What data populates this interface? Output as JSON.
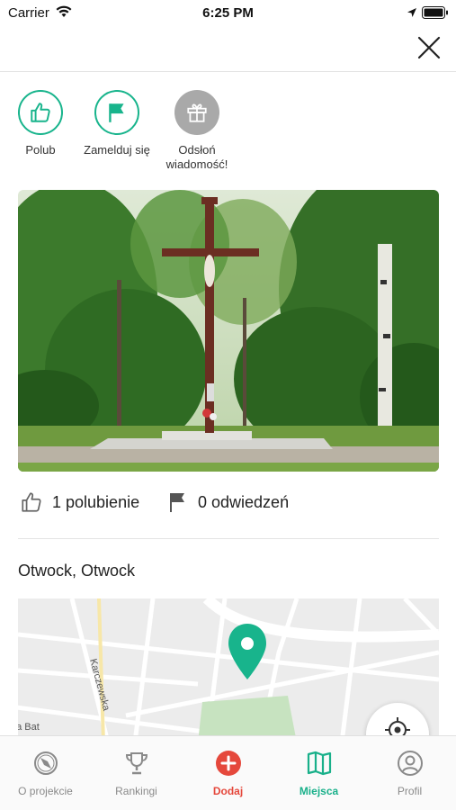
{
  "status_bar": {
    "carrier": "Carrier",
    "time": "6:25 PM"
  },
  "actions": [
    {
      "label": "Polub",
      "icon": "thumbs-up-icon"
    },
    {
      "label": "Zamelduj się",
      "icon": "flag-icon"
    },
    {
      "label": "Odsłoń\nwiadomość!",
      "icon": "gift-icon"
    }
  ],
  "stats": {
    "likes": "1 polubienie",
    "visits": "0 odwiedzeń"
  },
  "location": "Otwock, Otwock",
  "map": {
    "street_1": "Karczewska",
    "street_2": "na Bat"
  },
  "tabbar": {
    "items": [
      {
        "label": "O projekcie",
        "icon": "compass-icon"
      },
      {
        "label": "Rankingi",
        "icon": "trophy-icon"
      },
      {
        "label": "Dodaj",
        "icon": "add-circle-icon"
      },
      {
        "label": "Miejsca",
        "icon": "map-icon"
      },
      {
        "label": "Profil",
        "icon": "profile-icon"
      }
    ]
  },
  "colors": {
    "accent_green": "#18b48c",
    "accent_red": "#e5483c",
    "inactive": "#8a8a8a"
  }
}
